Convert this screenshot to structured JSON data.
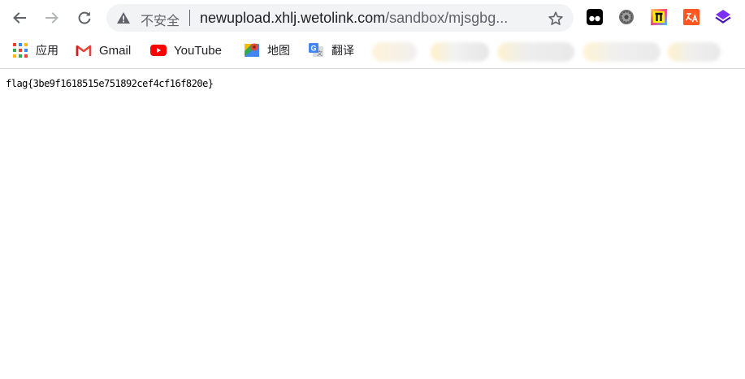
{
  "browser": {
    "security_label": "不安全",
    "url_host": "newupload.xhlj.wetolink.com",
    "url_path": "/sandbox/mjsgbg...",
    "nav": {
      "back_icon": "arrow-left-icon",
      "forward_icon": "arrow-right-icon",
      "reload_icon": "reload-icon"
    },
    "extensions": [
      "tampermonkey-icon",
      "settings-gear-extension-icon",
      "pi-extension-icon",
      "translate-extension-icon",
      "purple-layers-extension-icon"
    ]
  },
  "bookmarks": {
    "items": [
      {
        "label": "应用",
        "icon": "apps-grid-icon"
      },
      {
        "label": "Gmail",
        "icon": "gmail-icon"
      },
      {
        "label": "YouTube",
        "icon": "youtube-icon"
      },
      {
        "label": "地图",
        "icon": "maps-icon"
      },
      {
        "label": "翻译",
        "icon": "google-translate-icon"
      }
    ]
  },
  "page": {
    "text": "flag{3be9f1618515e751892cef4cf16f820e}"
  },
  "colors": {
    "omnibox_bg": "#f1f3f4",
    "youtube_red": "#ff0000",
    "gmail_red": "#ea4335",
    "ext_purple": "#5f1ecf",
    "ext_orange": "#ff5722"
  }
}
